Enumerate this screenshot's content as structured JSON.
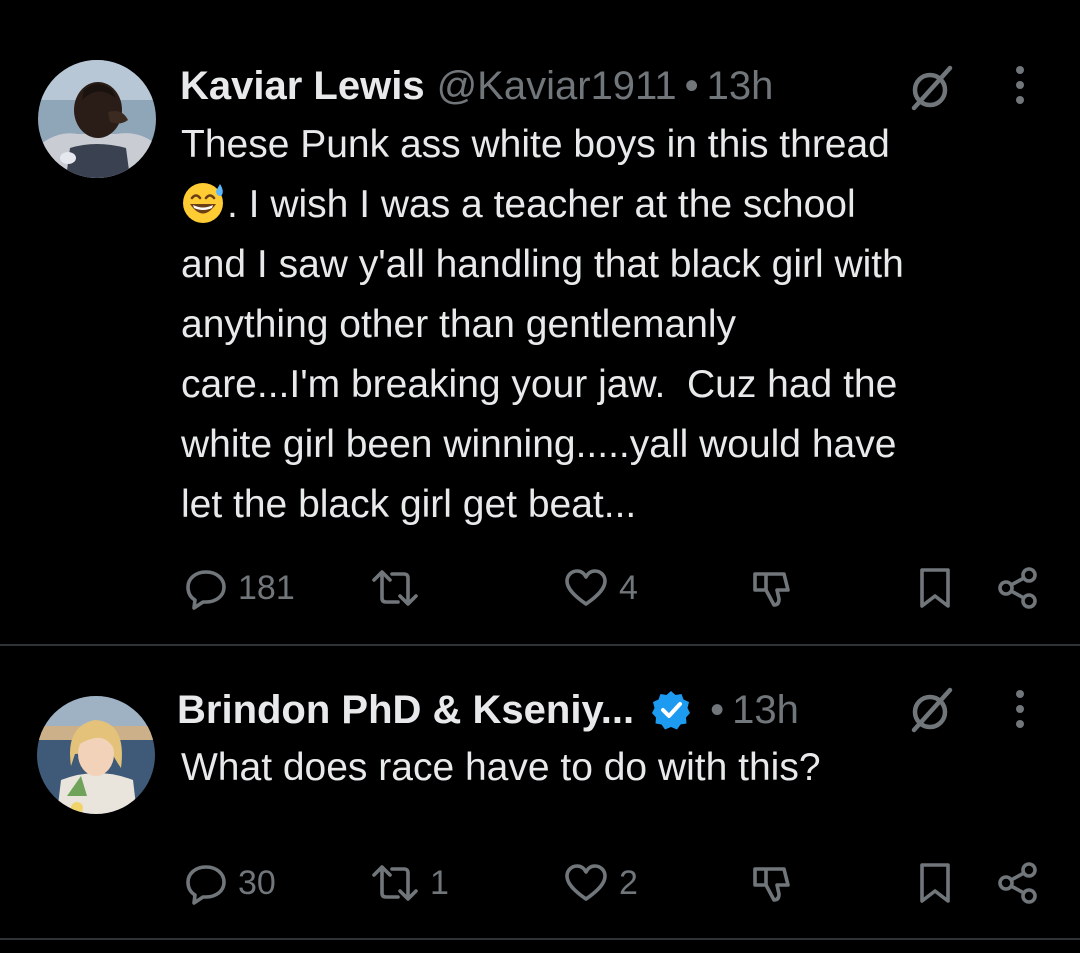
{
  "colors": {
    "background": "#000000",
    "text_primary": "#e7e9ea",
    "text_secondary": "#71767b",
    "divider": "#2f3336",
    "verified_blue": "#1d9bf0"
  },
  "posts": [
    {
      "author_name": "Kaviar Lewis",
      "handle": "@Kaviar1911",
      "separator": "•",
      "time": "13h",
      "verified": false,
      "text_before_emoji": "These Punk ass white boys in this thread\n",
      "emoji": "grinning-face-with-sweat-emoji",
      "text_after_emoji": ". I wish I was a teacher at the school\nand I saw y'all handling that black girl with\nanything other than gentlemanly\ncare...I'm breaking your jaw.  Cuz had the\nwhite girl been winning.....yall would have\nlet the black girl get beat...",
      "reply_count": "181",
      "repost_count": "",
      "like_count": "4",
      "icons": [
        "reply-icon",
        "repost-icon",
        "like-icon",
        "dislike-icon",
        "bookmark-icon",
        "share-icon",
        "grok-icon",
        "more-icon"
      ]
    },
    {
      "author_name": "Brindon PhD & Kseniy...",
      "handle": "",
      "separator": "•",
      "time": "13h",
      "verified": true,
      "text": "What does race have to do with this?",
      "reply_count": "30",
      "repost_count": "1",
      "like_count": "2",
      "icons": [
        "reply-icon",
        "repost-icon",
        "like-icon",
        "dislike-icon",
        "bookmark-icon",
        "share-icon",
        "grok-icon",
        "more-icon",
        "verified-badge-icon"
      ]
    }
  ]
}
